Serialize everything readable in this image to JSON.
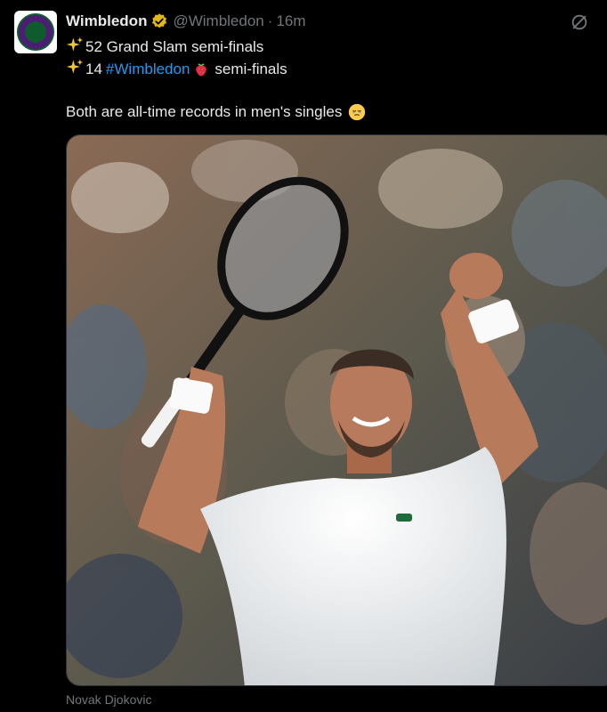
{
  "tweet": {
    "author_name": "Wimbledon",
    "handle": "@Wimbledon",
    "separator": "·",
    "timestamp": "16m",
    "line1_icon": "sparkles-icon",
    "line1_text": "52 Grand Slam semi-finals",
    "line2_icon": "sparkles-icon",
    "line2_number": "14",
    "line2_hashtag": "#Wimbledon",
    "line2_emoji": "strawberry-icon",
    "line2_text": "semi-finals",
    "line3_text": "Both are all-time records in men's singles",
    "line3_emoji": "face-holding-back-tears-icon"
  },
  "media": {
    "caption": "Novak Djokovic"
  },
  "colors": {
    "background": "#000000",
    "text": "#e7e9ea",
    "muted": "#71767b",
    "link": "#1d9bf0",
    "verified": "#e2b719"
  }
}
